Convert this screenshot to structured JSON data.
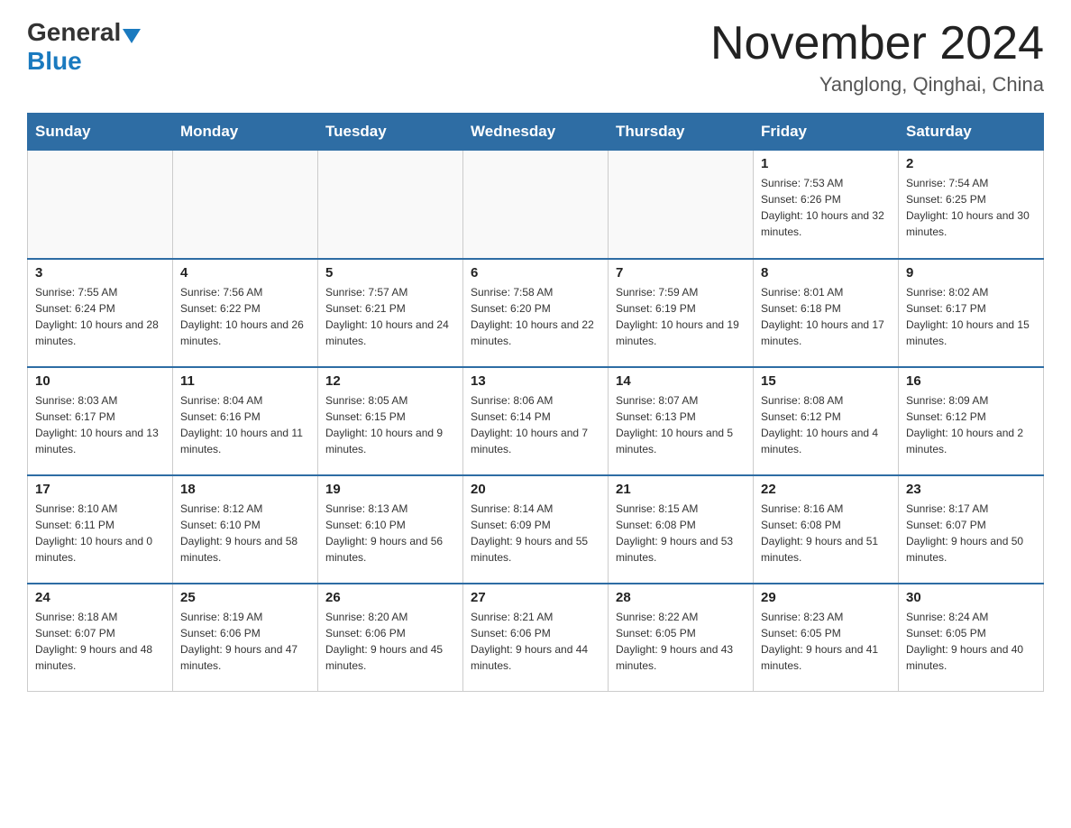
{
  "header": {
    "logo_general": "General",
    "logo_blue": "Blue",
    "month_title": "November 2024",
    "location": "Yanglong, Qinghai, China"
  },
  "days_of_week": [
    "Sunday",
    "Monday",
    "Tuesday",
    "Wednesday",
    "Thursday",
    "Friday",
    "Saturday"
  ],
  "weeks": [
    [
      {
        "day": "",
        "sunrise": "",
        "sunset": "",
        "daylight": ""
      },
      {
        "day": "",
        "sunrise": "",
        "sunset": "",
        "daylight": ""
      },
      {
        "day": "",
        "sunrise": "",
        "sunset": "",
        "daylight": ""
      },
      {
        "day": "",
        "sunrise": "",
        "sunset": "",
        "daylight": ""
      },
      {
        "day": "",
        "sunrise": "",
        "sunset": "",
        "daylight": ""
      },
      {
        "day": "1",
        "sunrise": "Sunrise: 7:53 AM",
        "sunset": "Sunset: 6:26 PM",
        "daylight": "Daylight: 10 hours and 32 minutes."
      },
      {
        "day": "2",
        "sunrise": "Sunrise: 7:54 AM",
        "sunset": "Sunset: 6:25 PM",
        "daylight": "Daylight: 10 hours and 30 minutes."
      }
    ],
    [
      {
        "day": "3",
        "sunrise": "Sunrise: 7:55 AM",
        "sunset": "Sunset: 6:24 PM",
        "daylight": "Daylight: 10 hours and 28 minutes."
      },
      {
        "day": "4",
        "sunrise": "Sunrise: 7:56 AM",
        "sunset": "Sunset: 6:22 PM",
        "daylight": "Daylight: 10 hours and 26 minutes."
      },
      {
        "day": "5",
        "sunrise": "Sunrise: 7:57 AM",
        "sunset": "Sunset: 6:21 PM",
        "daylight": "Daylight: 10 hours and 24 minutes."
      },
      {
        "day": "6",
        "sunrise": "Sunrise: 7:58 AM",
        "sunset": "Sunset: 6:20 PM",
        "daylight": "Daylight: 10 hours and 22 minutes."
      },
      {
        "day": "7",
        "sunrise": "Sunrise: 7:59 AM",
        "sunset": "Sunset: 6:19 PM",
        "daylight": "Daylight: 10 hours and 19 minutes."
      },
      {
        "day": "8",
        "sunrise": "Sunrise: 8:01 AM",
        "sunset": "Sunset: 6:18 PM",
        "daylight": "Daylight: 10 hours and 17 minutes."
      },
      {
        "day": "9",
        "sunrise": "Sunrise: 8:02 AM",
        "sunset": "Sunset: 6:17 PM",
        "daylight": "Daylight: 10 hours and 15 minutes."
      }
    ],
    [
      {
        "day": "10",
        "sunrise": "Sunrise: 8:03 AM",
        "sunset": "Sunset: 6:17 PM",
        "daylight": "Daylight: 10 hours and 13 minutes."
      },
      {
        "day": "11",
        "sunrise": "Sunrise: 8:04 AM",
        "sunset": "Sunset: 6:16 PM",
        "daylight": "Daylight: 10 hours and 11 minutes."
      },
      {
        "day": "12",
        "sunrise": "Sunrise: 8:05 AM",
        "sunset": "Sunset: 6:15 PM",
        "daylight": "Daylight: 10 hours and 9 minutes."
      },
      {
        "day": "13",
        "sunrise": "Sunrise: 8:06 AM",
        "sunset": "Sunset: 6:14 PM",
        "daylight": "Daylight: 10 hours and 7 minutes."
      },
      {
        "day": "14",
        "sunrise": "Sunrise: 8:07 AM",
        "sunset": "Sunset: 6:13 PM",
        "daylight": "Daylight: 10 hours and 5 minutes."
      },
      {
        "day": "15",
        "sunrise": "Sunrise: 8:08 AM",
        "sunset": "Sunset: 6:12 PM",
        "daylight": "Daylight: 10 hours and 4 minutes."
      },
      {
        "day": "16",
        "sunrise": "Sunrise: 8:09 AM",
        "sunset": "Sunset: 6:12 PM",
        "daylight": "Daylight: 10 hours and 2 minutes."
      }
    ],
    [
      {
        "day": "17",
        "sunrise": "Sunrise: 8:10 AM",
        "sunset": "Sunset: 6:11 PM",
        "daylight": "Daylight: 10 hours and 0 minutes."
      },
      {
        "day": "18",
        "sunrise": "Sunrise: 8:12 AM",
        "sunset": "Sunset: 6:10 PM",
        "daylight": "Daylight: 9 hours and 58 minutes."
      },
      {
        "day": "19",
        "sunrise": "Sunrise: 8:13 AM",
        "sunset": "Sunset: 6:10 PM",
        "daylight": "Daylight: 9 hours and 56 minutes."
      },
      {
        "day": "20",
        "sunrise": "Sunrise: 8:14 AM",
        "sunset": "Sunset: 6:09 PM",
        "daylight": "Daylight: 9 hours and 55 minutes."
      },
      {
        "day": "21",
        "sunrise": "Sunrise: 8:15 AM",
        "sunset": "Sunset: 6:08 PM",
        "daylight": "Daylight: 9 hours and 53 minutes."
      },
      {
        "day": "22",
        "sunrise": "Sunrise: 8:16 AM",
        "sunset": "Sunset: 6:08 PM",
        "daylight": "Daylight: 9 hours and 51 minutes."
      },
      {
        "day": "23",
        "sunrise": "Sunrise: 8:17 AM",
        "sunset": "Sunset: 6:07 PM",
        "daylight": "Daylight: 9 hours and 50 minutes."
      }
    ],
    [
      {
        "day": "24",
        "sunrise": "Sunrise: 8:18 AM",
        "sunset": "Sunset: 6:07 PM",
        "daylight": "Daylight: 9 hours and 48 minutes."
      },
      {
        "day": "25",
        "sunrise": "Sunrise: 8:19 AM",
        "sunset": "Sunset: 6:06 PM",
        "daylight": "Daylight: 9 hours and 47 minutes."
      },
      {
        "day": "26",
        "sunrise": "Sunrise: 8:20 AM",
        "sunset": "Sunset: 6:06 PM",
        "daylight": "Daylight: 9 hours and 45 minutes."
      },
      {
        "day": "27",
        "sunrise": "Sunrise: 8:21 AM",
        "sunset": "Sunset: 6:06 PM",
        "daylight": "Daylight: 9 hours and 44 minutes."
      },
      {
        "day": "28",
        "sunrise": "Sunrise: 8:22 AM",
        "sunset": "Sunset: 6:05 PM",
        "daylight": "Daylight: 9 hours and 43 minutes."
      },
      {
        "day": "29",
        "sunrise": "Sunrise: 8:23 AM",
        "sunset": "Sunset: 6:05 PM",
        "daylight": "Daylight: 9 hours and 41 minutes."
      },
      {
        "day": "30",
        "sunrise": "Sunrise: 8:24 AM",
        "sunset": "Sunset: 6:05 PM",
        "daylight": "Daylight: 9 hours and 40 minutes."
      }
    ]
  ]
}
